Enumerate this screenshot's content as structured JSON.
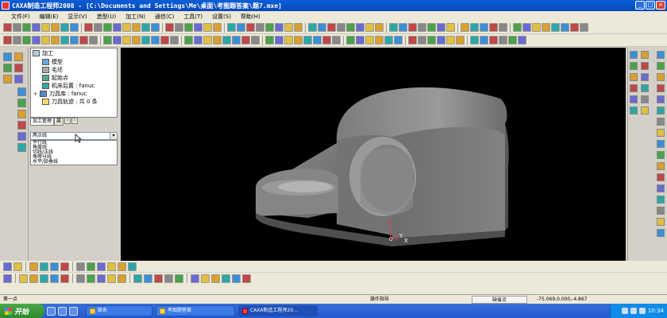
{
  "window": {
    "title": "CAXA制造工程师2008  - [C:\\Documents and Settings\\Me\\桌面\\考图题答案\\题7.mxe]"
  },
  "menu": [
    "文件(F)",
    "编辑(E)",
    "显示(V)",
    "造型(U)",
    "加工(N)",
    "通信(C)",
    "工具(T)",
    "设置(S)",
    "帮助(H)"
  ],
  "tree": {
    "root": "加工",
    "items": [
      "模型",
      "毛坯",
      "起始点",
      "机床后置 : fanuc",
      "刀具库 : fanuc",
      "刀具轨迹 : 共 0 条"
    ]
  },
  "tabs": {
    "tab1": "加工管理",
    "tab2": "属"
  },
  "combo": {
    "value": "两点线",
    "options": [
      "平行线",
      "角度线",
      "切线/法线",
      "角等分线",
      "水平/铅垂线"
    ]
  },
  "status": {
    "left": "第一点",
    "center": "操作指导",
    "mode": "缺省点",
    "coords": "-75.069,0.000,-4.867"
  },
  "axis": {
    "z": "Z",
    "y": "Y",
    "x": "X",
    "o": "O"
  },
  "taskbar": {
    "start": "开始",
    "tasks": [
      "联系",
      "考图题答案",
      "CAXA制造工程师20..."
    ],
    "time": "10:34"
  },
  "colors": {
    "title": "#0a5ed8",
    "viewport": "#000000",
    "model": "#7a7a7a",
    "taskbar": "#245ad0",
    "start": "#3a9a38"
  }
}
